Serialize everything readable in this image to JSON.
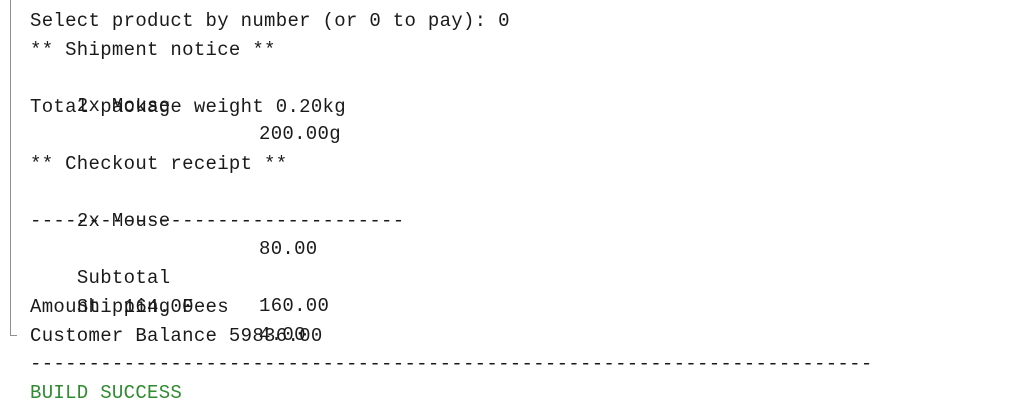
{
  "console": {
    "prompt": "Select product by number (or 0 to pay): 0",
    "shipment_header": "** Shipment notice **",
    "shipment_item": {
      "name": "2x Mouse",
      "value": "200.00g"
    },
    "package_weight": "Total package weight 0.20kg",
    "receipt_header": "** Checkout receipt **",
    "receipt_item": {
      "name": "2x Mouse",
      "value": "80.00"
    },
    "divider_short": "--------------------------------",
    "subtotal": {
      "label": "Subtotal",
      "value": "160.00"
    },
    "shipping": {
      "label": "Shipping Fees",
      "value": "4.00"
    },
    "amount": "Amount  164.00",
    "balance": "Customer Balance 59836.00",
    "divider_long": "------------------------------------------------------------------------",
    "build_status": "BUILD SUCCESS"
  },
  "colors": {
    "text": "#1a1a1a",
    "success": "#2e8b2e",
    "gutter": "#8f8f8f"
  }
}
